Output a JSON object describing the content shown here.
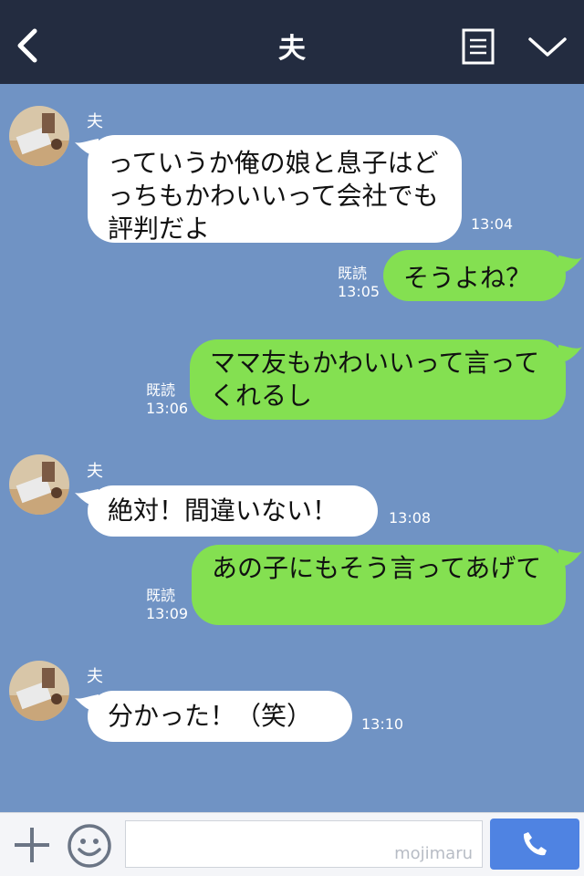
{
  "header": {
    "title": "夫",
    "icons": [
      "back-icon",
      "menu-icon",
      "chevron-down-icon"
    ]
  },
  "chat": {
    "messages": [
      {
        "direction": "in",
        "sender": "夫",
        "text": "っていうか俺の娘と息子はどっちもかわいいって会社でも評判だよ",
        "time": "13:04"
      },
      {
        "direction": "out",
        "read_label": "既読",
        "text": "そうよね？",
        "time": "13:05"
      },
      {
        "direction": "out",
        "read_label": "既読",
        "text": "ママ友もかわいいって言ってくれるし",
        "time": "13:06"
      },
      {
        "direction": "in",
        "sender": "夫",
        "text": "絶対！間違いない！",
        "time": "13:08"
      },
      {
        "direction": "out",
        "read_label": "既読",
        "text": "あの子にもそう言ってあげて",
        "time": "13:09"
      },
      {
        "direction": "in",
        "sender": "夫",
        "text": "分かった！（笑）",
        "time": "13:10"
      }
    ]
  },
  "input_bar": {
    "watermark": "mojimaru",
    "icons": [
      "plus-icon",
      "smiley-icon",
      "phone-icon"
    ]
  },
  "colors": {
    "header_bg": "#232c40",
    "chat_bg": "#7093c4",
    "incoming_bubble": "#ffffff",
    "outgoing_bubble": "#84e051",
    "call_button": "#4f83e2"
  }
}
